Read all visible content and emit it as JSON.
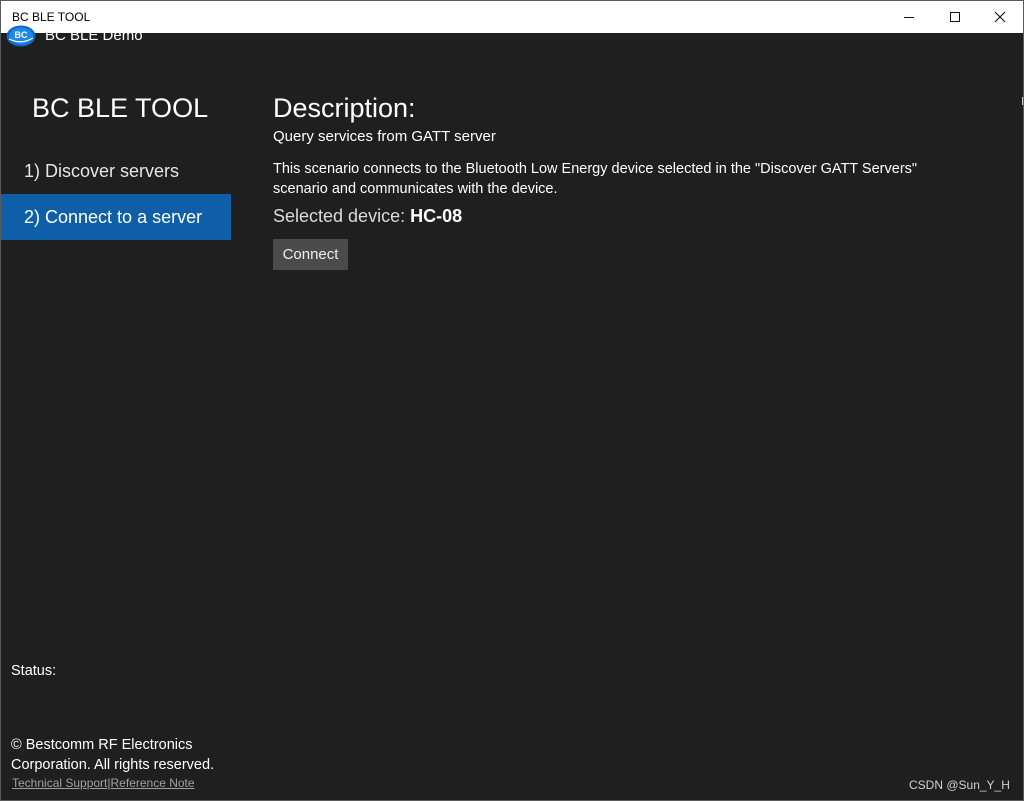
{
  "window": {
    "title": "BC BLE TOOL",
    "minimize_icon": "minimize-icon",
    "maximize_icon": "maximize-icon",
    "close_icon": "close-icon"
  },
  "header": {
    "app_title": "BC BLE Demo",
    "logo_icon": "bc-logo-icon",
    "logo_text": "BC"
  },
  "sidebar": {
    "heading": "BC BLE TOOL",
    "items": [
      {
        "label": "1) Discover servers",
        "selected": false
      },
      {
        "label": "2) Connect to a server",
        "selected": true
      }
    ]
  },
  "main": {
    "description_title": "Description:",
    "description_subtitle": "Query services from GATT server",
    "description_body": "This scenario connects to the Bluetooth Low Energy device selected in the \"Discover GATT Servers\" scenario and communicates with the device.",
    "selected_device_label": "Selected device:",
    "selected_device_value": "HC-08",
    "connect_label": "Connect"
  },
  "status": {
    "label": "Status:"
  },
  "footer": {
    "copyright": "© Bestcomm RF Electronics Corporation. All rights reserved.",
    "technical_support": "Technical Support",
    "separator": "|",
    "reference_note": "Reference Note"
  },
  "watermark": "CSDN @Sun_Y_H",
  "colors": {
    "background": "#1f1f1f",
    "selected_nav": "#0f5fa8",
    "button": "#4b4b4b",
    "titlebar": "#ffffff"
  }
}
